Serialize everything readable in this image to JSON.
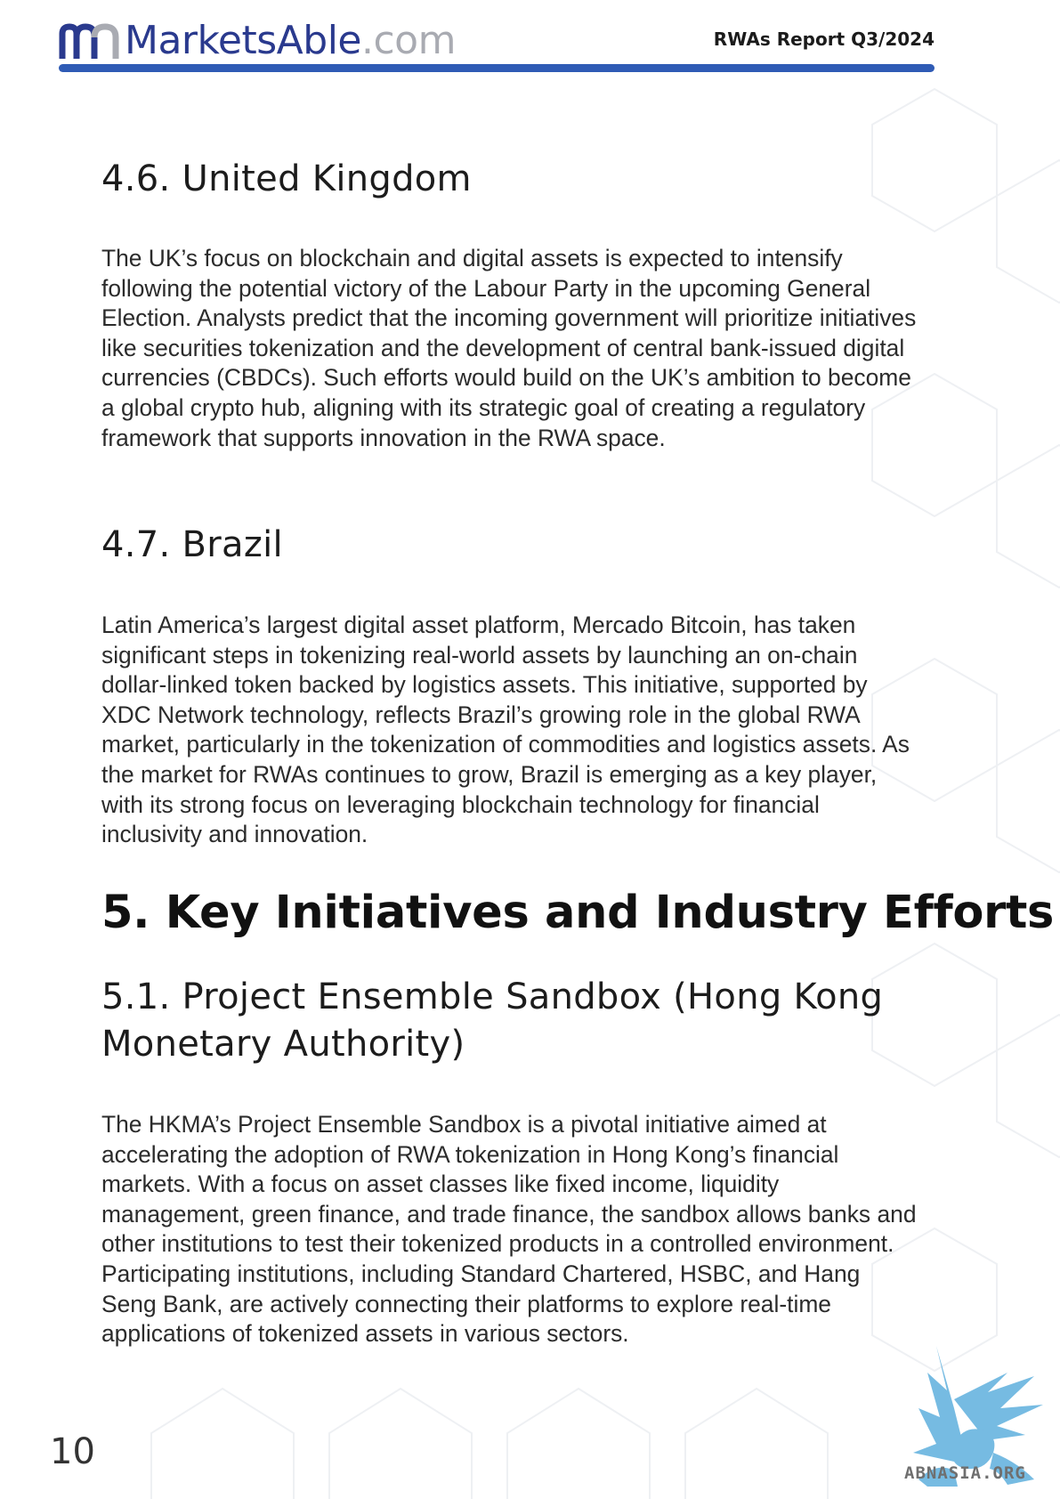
{
  "header": {
    "logo_name": "MarketsAble",
    "logo_tld": ".com",
    "report_title": "RWAs Report Q3/2024"
  },
  "sections": {
    "uk": {
      "heading": "4.6. United Kingdom",
      "body": "The UK’s focus on blockchain and digital assets is expected to intensify following the potential victory of the Labour Party in the upcoming General Election. Analysts predict that the incoming government will prioritize initiatives like securities tokenization and the development of central bank-issued digital currencies (CBDCs). Such efforts would build on the UK’s ambition to become a global crypto hub, aligning with its strategic goal of creating a regulatory framework that supports innovation in the RWA space."
    },
    "brazil": {
      "heading": "4.7. Brazil",
      "body": "Latin America’s largest digital asset platform, Mercado Bitcoin, has taken significant steps in tokenizing real-world assets by launching an on-chain dollar-linked token backed by logistics assets. This initiative, supported by XDC Network technology, reflects Brazil’s growing role in the global RWA market, particularly in the tokenization of commodities and logistics assets. As the market for RWAs continues to grow, Brazil is emerging as a key player, with its strong focus on leveraging blockchain technology for financial inclusivity and innovation."
    },
    "key_initiatives": {
      "heading": "5. Key Initiatives and Industry Efforts"
    },
    "ensemble": {
      "heading_line1": "5.1. Project Ensemble Sandbox (Hong Kong",
      "heading_line2": "Monetary Authority)",
      "body": "The HKMA’s Project Ensemble Sandbox is a pivotal initiative aimed at accelerating the adoption of RWA tokenization in Hong Kong’s financial markets. With a focus on asset classes like fixed income, liquidity management, green finance, and trade finance, the sandbox allows banks and other institutions to test their tokenized products in a controlled environment. Participating institutions, including Standard Chartered, HSBC, and Hang Seng Bank, are actively connecting their platforms to explore real-time applications of tokenized assets in various sectors."
    }
  },
  "footer": {
    "page_number": "10",
    "watermark_text": "ABNASIA.ORG"
  },
  "colors": {
    "brand_navy": "#2a3a8e",
    "rule_blue": "#2f5bb5",
    "watermark_blue": "#5fb0dd"
  }
}
